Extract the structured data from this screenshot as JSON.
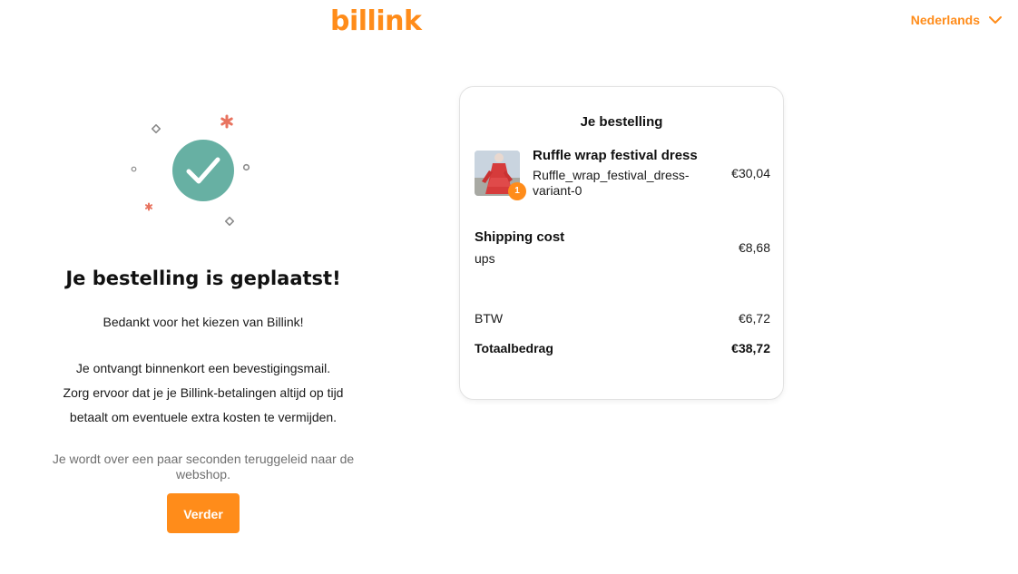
{
  "header": {
    "logo_text": "billink",
    "language": "Nederlands"
  },
  "confirmation": {
    "title": "Je bestelling is geplaatst!",
    "thanks": "Bedankt voor het kiezen van Billink!",
    "info_lines": [
      "Je ontvangt binnenkort een bevestigingsmail.",
      "Zorg ervoor dat je je Billink-betalingen altijd op tijd",
      "betaalt om eventuele extra kosten te vermijden."
    ],
    "redirect_lines": [
      "Je wordt over een paar seconden teruggeleid naar de",
      "webshop."
    ],
    "button_label": "Verder"
  },
  "order": {
    "title": "Je bestelling",
    "product": {
      "name": "Ruffle wrap festival dress",
      "variant": "Ruffle_wrap_festival_dress-variant-0",
      "quantity": "1",
      "price": "€30,04"
    },
    "shipping": {
      "label": "Shipping cost",
      "method": "ups",
      "price": "€8,68"
    },
    "btw": {
      "label": "BTW",
      "value": "€6,72"
    },
    "total": {
      "label": "Totaalbedrag",
      "value": "€38,72"
    }
  },
  "colors": {
    "brand": "#ff8c1a",
    "success": "#67b0a3",
    "accent_red": "#e8735f"
  },
  "icons": {
    "language_toggle": "chevron-down-icon",
    "success": "check-circle-icon"
  }
}
